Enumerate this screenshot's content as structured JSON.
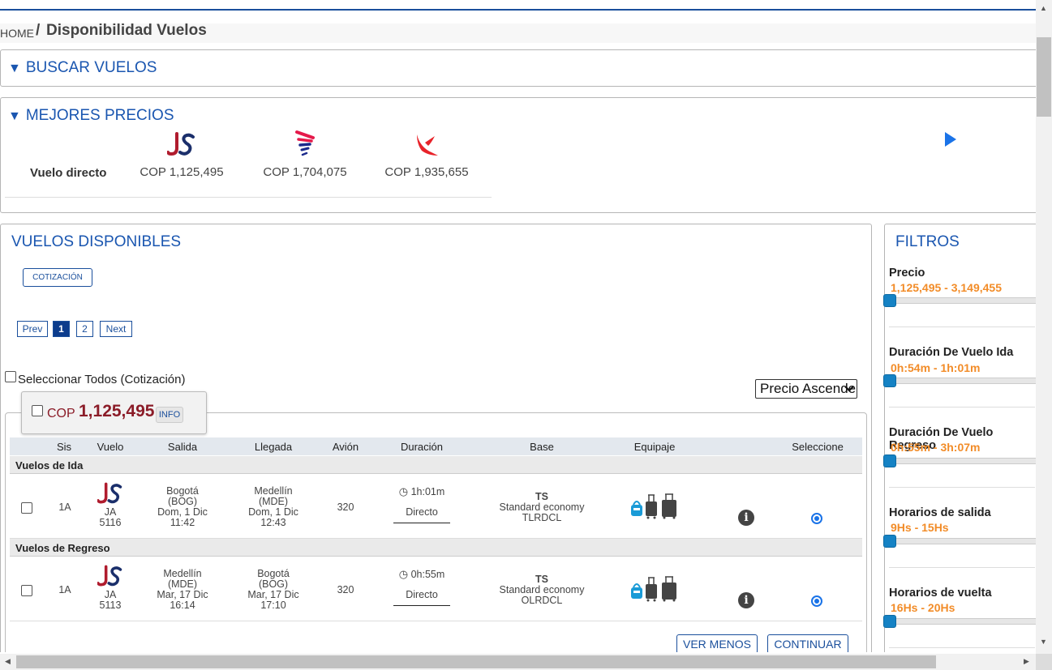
{
  "breadcrumb": {
    "home": "HOME",
    "separator": "/",
    "title": "Disponibilidad Vuelos"
  },
  "search_panel": {
    "title": "BUSCAR VUELOS",
    "arrow": "▼"
  },
  "best_prices": {
    "title": "MEJORES PRECIOS",
    "arrow": "▼",
    "row_label": "Vuelo directo",
    "airlines": [
      {
        "logo": "jetsmart-logo",
        "price": "COP 1,125,495"
      },
      {
        "logo": "latam-logo",
        "price": "COP 1,704,075"
      },
      {
        "logo": "avianca-logo",
        "price": "COP 1,935,655"
      }
    ]
  },
  "flights": {
    "title": "VUELOS DISPONIBLES",
    "quote_button": "COTIZACIÓN",
    "pager": {
      "prev": "Prev",
      "pages": [
        "1",
        "2"
      ],
      "active": "1",
      "next": "Next"
    },
    "select_all": "Seleccionar Todos (Cotización)",
    "sort": {
      "selected": "Precio Ascendente",
      "arrow": "▾"
    },
    "offer": {
      "currency": "COP",
      "amount": "1,125,495",
      "info": "INFO",
      "headers": [
        "Sis",
        "Vuelo",
        "Salida",
        "Llegada",
        "Avión",
        "Duración",
        "Base",
        "Equipaje",
        "Seleccione"
      ],
      "sections": [
        {
          "label": "Vuelos de Ida",
          "rows": [
            {
              "sis": "1A",
              "airline_code": "JA",
              "flight_number": "5116",
              "dep_city": "Bogotá",
              "dep_code": "(BOG)",
              "dep_date": "Dom, 1 Dic",
              "dep_time": "11:42",
              "arr_city": "Medellín",
              "arr_code": "(MDE)",
              "arr_date": "Dom, 1 Dic",
              "arr_time": "12:43",
              "aircraft": "320",
              "duration": "1h:01m",
              "stops": "Directo",
              "fare_code": "TS",
              "fare_name": "Standard economy",
              "fare_basis": "TLRDCL",
              "info_glyph": "i"
            }
          ]
        },
        {
          "label": "Vuelos de Regreso",
          "rows": [
            {
              "sis": "1A",
              "airline_code": "JA",
              "flight_number": "5113",
              "dep_city": "Medellín",
              "dep_code": "(MDE)",
              "dep_date": "Mar, 17 Dic",
              "dep_time": "16:14",
              "arr_city": "Bogotá",
              "arr_code": "(BOG)",
              "arr_date": "Mar, 17 Dic",
              "arr_time": "17:10",
              "aircraft": "320",
              "duration": "0h:55m",
              "stops": "Directo",
              "fare_code": "TS",
              "fare_name": "Standard economy",
              "fare_basis": "OLRDCL",
              "info_glyph": "i"
            }
          ]
        }
      ],
      "see_less": "VER MENOS",
      "continue": "CONTINUAR"
    }
  },
  "filters": {
    "title": "FILTROS",
    "items": [
      {
        "label": "Precio",
        "range": "1,125,495 - 3,149,455"
      },
      {
        "label": "Duración De Vuelo Ida",
        "range": "0h:54m - 1h:01m"
      },
      {
        "label": "Duración De Vuelo Regreso",
        "range": "0h:55m - 3h:07m"
      },
      {
        "label": "Horarios de salida",
        "range": "9Hs - 15Hs"
      },
      {
        "label": "Horarios de vuelta",
        "range": "16Hs - 20Hs"
      }
    ]
  },
  "colors": {
    "accent": "#1a56b0",
    "price": "#8b1c28",
    "filter_range": "#f28c28",
    "slider": "#1582c4"
  }
}
